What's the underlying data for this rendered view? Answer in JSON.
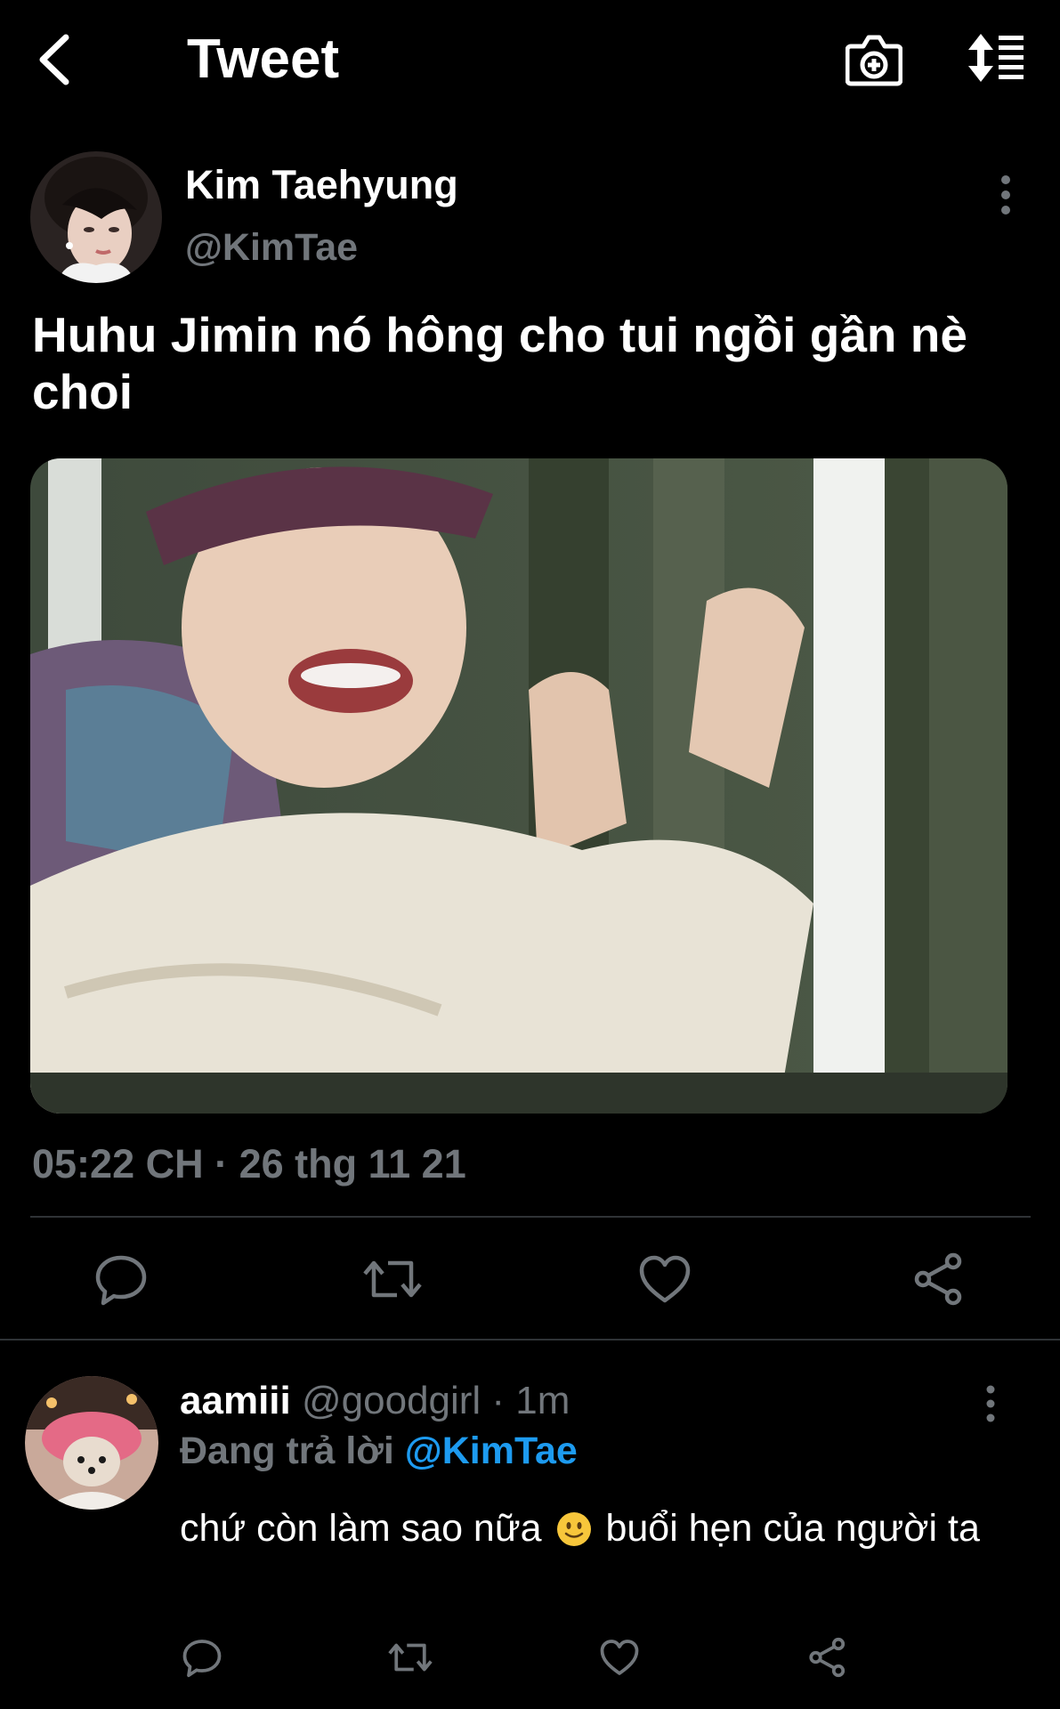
{
  "header": {
    "title": "Tweet",
    "back_icon": "arrow-left-icon",
    "camera_icon": "camera-plus-icon",
    "sort_icon": "sort-list-icon"
  },
  "tweet": {
    "author_name": "Kim Taehyung",
    "author_handle": "@KimTae",
    "text": "Huhu Jimin nó hông cho tui ngồi gần nè choi",
    "timestamp": "05:22 CH · 26 thg 11 21",
    "actions": [
      "reply-icon",
      "retweet-icon",
      "like-icon",
      "share-icon"
    ]
  },
  "reply": {
    "author_name": "aamiii",
    "author_meta": "@goodgirl · 1m",
    "replying_label": "Đang trả lời",
    "replying_to": "@KimTae",
    "text_before": "chứ còn làm sao nữa",
    "text_after": "buổi hẹn của người ta",
    "emoji": "slightly-smiling-face-emoji",
    "actions": [
      "reply-icon",
      "retweet-icon",
      "like-icon",
      "share-icon"
    ]
  },
  "colors": {
    "background": "#000000",
    "text": "#ffffff",
    "secondary": "#71767b",
    "mention": "#1d9bf0",
    "divider": "#2f3336"
  }
}
